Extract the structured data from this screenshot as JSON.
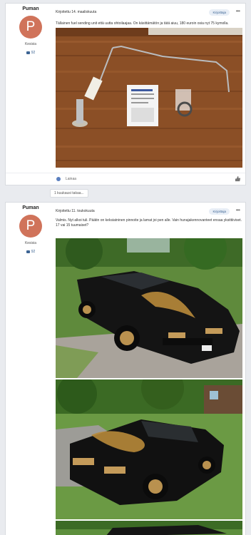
{
  "posts": [
    {
      "author": "Puman",
      "avatar_letter": "P",
      "role": "Kesisia",
      "post_count": "92",
      "meta": "Kirjoitettu 14. maaliskuuta",
      "quote": "Kirjoittaja",
      "text": "Tällainen fuel sending unit että uutta ohtoilaajaa. On käsittämätön ja tätä aiuu, 180 euroin osia nyt 75 kymolla.",
      "like_label": "Lainaa"
    },
    {
      "author": "Puman",
      "avatar_letter": "P",
      "role": "Kesisia",
      "post_count": "92",
      "meta": "Kirjoitettu 11. toukokuuta",
      "quote": "Kirjoittaja",
      "text": "Valmis. Nyt alkoi tuli. Päätin on keksiatninen pinnoite ja lamat joi pen alle. Vain hunajakennovanteet ensaa yksittiiviset. 17 vai 15 tuumaiset?"
    }
  ],
  "separator": "1 kuukausi takaa..."
}
